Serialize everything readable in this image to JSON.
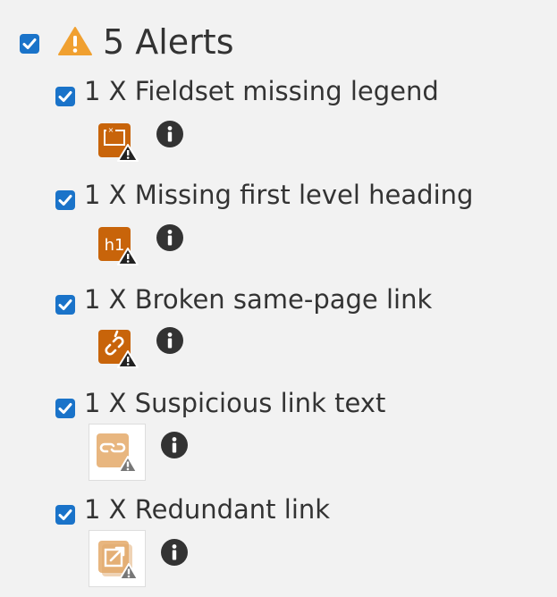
{
  "header": {
    "title": "5 Alerts",
    "checked": true,
    "icon": "warning-triangle-icon",
    "accent_color": "#f0a030"
  },
  "alerts": [
    {
      "label": "1 X Fieldset missing legend",
      "icon": "fieldset-missing-legend-icon",
      "info_icon": "info-icon",
      "checked": true
    },
    {
      "label": "1 X Missing first level heading",
      "icon": "missing-h1-icon",
      "icon_text": "h1",
      "info_icon": "info-icon",
      "checked": true
    },
    {
      "label": "1 X Broken same-page link",
      "icon": "broken-link-icon",
      "info_icon": "info-icon",
      "checked": true
    },
    {
      "label": "1 X Suspicious link text",
      "icon": "suspicious-link-icon",
      "info_icon": "info-icon",
      "checked": true
    },
    {
      "label": "1 X Redundant link",
      "icon": "redundant-link-icon",
      "info_icon": "info-icon",
      "checked": true
    }
  ],
  "colors": {
    "checkbox": "#1a73c9",
    "alert_tile": "#c8640a",
    "alert_tile_faded": "#e8b67f",
    "text": "#333333",
    "background": "#f2f2f2"
  }
}
